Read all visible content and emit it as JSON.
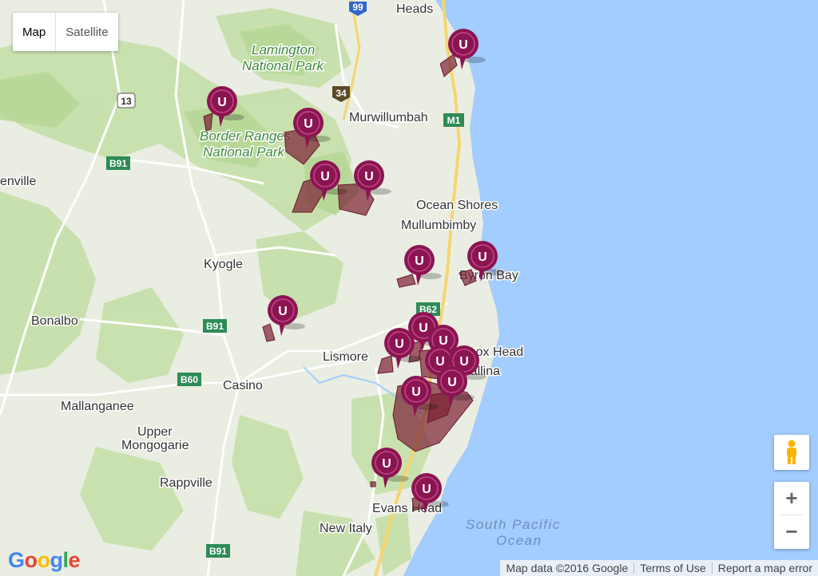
{
  "map_type": {
    "map_label": "Map",
    "satellite_label": "Satellite",
    "active": "Map"
  },
  "places": {
    "heads": "Heads",
    "lamington_1": "Lamington",
    "lamington_2": "National Park",
    "murwillumbah": "Murwillumbah",
    "border_1": "Border Ranges",
    "border_2": "National Park",
    "enville": "enville",
    "ocean_shores": "Ocean Shores",
    "mullumbimby": "Mullumbimby",
    "kyogle": "Kyogle",
    "byron_bay": "Byron Bay",
    "bonalbo": "Bonalbo",
    "lismore": "Lismore",
    "lennox_head": "Lennox Head",
    "ballina": "Ballina",
    "casino": "Casino",
    "mallanganee": "Mallanganee",
    "upper_1": "Upper",
    "upper_2": "Mongogarie",
    "rappville": "Rappville",
    "evans_head": "Evans Head",
    "new_italy": "New Italy",
    "ocean_1": "South Pacific",
    "ocean_2": "Ocean"
  },
  "roads": {
    "r99": "99",
    "r13": "13",
    "r34": "34",
    "m1": "M1",
    "b91_a": "B91",
    "b91_b": "B91",
    "b91_c": "B91",
    "b60": "B60",
    "b62": "B62"
  },
  "marker_letter": "U",
  "marker_color": "#8b1452",
  "area_color": "#7a1f33",
  "zoom": {
    "in": "+",
    "out": "−"
  },
  "logo": "Google",
  "attribution": {
    "data": "Map data ©2016 Google",
    "terms": "Terms of Use",
    "report": "Report a map error"
  }
}
